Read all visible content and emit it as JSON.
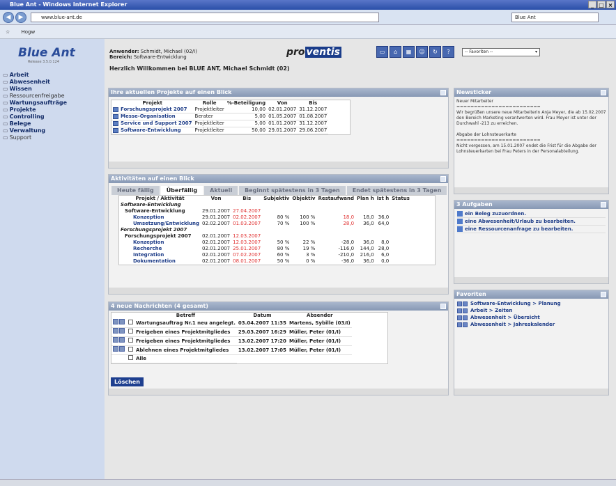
{
  "window": {
    "title": "Blue Ant - Windows Internet Explorer"
  },
  "browser": {
    "address": "www.blue-ant.de",
    "search_value": "Blue Ant",
    "tab_label": "Hogw"
  },
  "sidebar": {
    "logo": "Blue Ant",
    "logo_sub": "Release 3.5.0.124",
    "items": [
      {
        "label": "Arbeit",
        "sub": false
      },
      {
        "label": "Abwesenheit",
        "sub": false
      },
      {
        "label": "Wissen",
        "sub": false
      },
      {
        "label": "Ressourcenfreigabe",
        "sub": true
      },
      {
        "label": "Wartungsaufträge",
        "sub": false
      },
      {
        "label": "Projekte",
        "sub": false
      },
      {
        "label": "Controlling",
        "sub": false
      },
      {
        "label": "Belege",
        "sub": false
      },
      {
        "label": "Verwaltung",
        "sub": false
      },
      {
        "label": "Support",
        "sub": true
      }
    ]
  },
  "header": {
    "user_label": "Anwender:",
    "user_value": "Schmidt, Michael (02/I)",
    "area_label": "Bereich:",
    "area_value": "Software-Entwicklung",
    "welcome": "Herzlich Willkommen bei BLUE ANT,  Michael Schmidt (02)",
    "brand_pre": "pro",
    "brand_post": "ventis",
    "favorites_select": "-- Favoriten --"
  },
  "projects": {
    "title": "Ihre aktuellen Projekte auf einen Blick",
    "columns": [
      "Projekt",
      "Rolle",
      "%-Beteiligung",
      "Von",
      "Bis"
    ],
    "rows": [
      [
        "Forschungsprojekt 2007",
        "Projektleiter",
        "10,00",
        "02.01.2007",
        "31.12.2007"
      ],
      [
        "Messe-Organisation",
        "Berater",
        "5,00",
        "01.05.2007",
        "01.08.2007"
      ],
      [
        "Service und Support 2007",
        "Projektleiter",
        "5,00",
        "01.01.2007",
        "31.12.2007"
      ],
      [
        "Software-Entwicklung",
        "Projektleiter",
        "50,00",
        "29.01.2007",
        "29.06.2007"
      ]
    ]
  },
  "activities": {
    "title": "Aktivitäten auf einen Blick",
    "tabs": [
      "Heute fällig",
      "Überfällig",
      "Aktuell",
      "Beginnt spätestens in 3 Tagen",
      "Endet spätestens in 3 Tagen"
    ],
    "columns": [
      "Projekt / Aktivität",
      "Von",
      "Bis",
      "Subjektiv",
      "Objektiv",
      "Restaufwand",
      "Plan h",
      "Ist h",
      "Status"
    ],
    "rows": [
      {
        "kind": "group",
        "name": "Software-Entwicklung"
      },
      {
        "kind": "project",
        "name": "Software-Entwicklung",
        "von": "29.01.2007",
        "bis": "27.04.2007"
      },
      {
        "kind": "task",
        "name": "Konzeption",
        "von": "29.01.2007",
        "bis": "02.02.2007",
        "subj": "80 %",
        "obj": "100 %",
        "rest": "18,0",
        "plan": "18,0",
        "ist": "36,0",
        "rest_red": true
      },
      {
        "kind": "task",
        "name": "Umsetzung/Entwicklung",
        "von": "02.02.2007",
        "bis": "01.03.2007",
        "subj": "70 %",
        "obj": "100 %",
        "rest": "28,0",
        "plan": "36,0",
        "ist": "64,0",
        "rest_red": true
      },
      {
        "kind": "group",
        "name": "Forschungsprojekt 2007"
      },
      {
        "kind": "project",
        "name": "Forschungsprojekt 2007",
        "von": "02.01.2007",
        "bis": "12.03.2007"
      },
      {
        "kind": "task",
        "name": "Konzeption",
        "von": "02.01.2007",
        "bis": "12.03.2007",
        "subj": "50 %",
        "obj": "22 %",
        "rest": "-28,0",
        "plan": "36,0",
        "ist": "8,0",
        "rest_red": false
      },
      {
        "kind": "task",
        "name": "Recherche",
        "von": "02.01.2007",
        "bis": "25.01.2007",
        "subj": "80 %",
        "obj": "19 %",
        "rest": "-116,0",
        "plan": "144,0",
        "ist": "28,0",
        "rest_red": false
      },
      {
        "kind": "task",
        "name": "Integration",
        "von": "02.01.2007",
        "bis": "07.02.2007",
        "subj": "60 %",
        "obj": "3 %",
        "rest": "-210,0",
        "plan": "216,0",
        "ist": "6,0",
        "rest_red": false
      },
      {
        "kind": "task",
        "name": "Dokumentation",
        "von": "02.01.2007",
        "bis": "08.01.2007",
        "subj": "50 %",
        "obj": "0 %",
        "rest": "-36,0",
        "plan": "36,0",
        "ist": "0,0",
        "rest_red": false
      }
    ]
  },
  "messages": {
    "title": "4 neue Nachrichten (4 gesamt)",
    "columns": [
      "Betreff",
      "Datum",
      "Absender"
    ],
    "rows": [
      [
        "Wartungsauftrag Nr.1 neu angelegt.",
        "03.04.2007 11:35",
        "Martens, Sybille (03/I)"
      ],
      [
        "Freigeben eines Projektmitgliedes",
        "29.03.2007 16:29",
        "Müller, Peter (01/I)"
      ],
      [
        "Freigeben eines Projektmitgliedes",
        "13.02.2007 17:20",
        "Müller, Peter (01/I)"
      ],
      [
        "Ablehnen eines Projektmitgliedes",
        "13.02.2007 17:05",
        "Müller, Peter (01/I)"
      ]
    ],
    "all_label": "Alle",
    "delete_button": "Löschen"
  },
  "newsticker": {
    "title": "Newsticker",
    "heading1": "Neuer Mitarbeiter",
    "separator": "========================",
    "text1": "Wir begrüßen unsere neue Mitarbeiterin Anja Meyer, die ab 15.02.2007 den Bereich Marketing verantworten wird. Frau Meyer ist unter der Durchwahl -213 zu erreichen.",
    "heading2": "Abgabe der Lohnsteuerkarte",
    "text2": "Nicht vergessen, am 15.01.2007 endet die Frist für die Abgabe der Lohnsteuerkarten bei Frau Peters in der Personalabteilung."
  },
  "tasks": {
    "title": "3 Aufgaben",
    "items": [
      "ein Beleg zuzuordnen.",
      "eine Abwesenheit/Urlaub zu bearbeiten.",
      "eine Ressourcenanfrage zu bearbeiten."
    ]
  },
  "favorites": {
    "title": "Favoriten",
    "items": [
      "Software-Entwicklung > Planung",
      "Arbeit > Zeiten",
      "Abwesenheit > Übersicht",
      "Abwesenheit > Jahreskalender"
    ]
  }
}
